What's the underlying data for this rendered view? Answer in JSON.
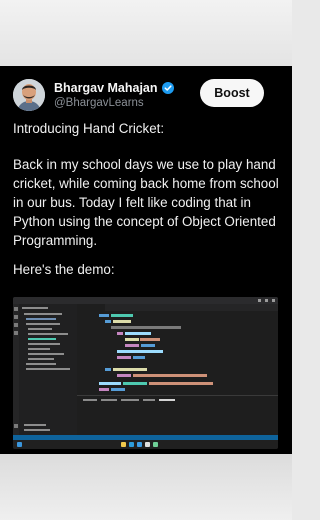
{
  "post": {
    "author_name": "Bhargav Mahajan",
    "author_handle": "@BhargavLearns",
    "verified": true,
    "action_button": "Boost",
    "paragraphs": [
      "Introducing Hand Cricket:",
      "Back in my school days we use to play hand cricket, while coming back home from school in our bus. Today I felt like coding that in Python using the concept of Object Oriented Programming.",
      "Here's the demo:"
    ]
  },
  "screenshot": {
    "code": [
      "class cricket:",
      "def play(self):",
      "if num==bowl:",
      "print(\"OUT!!\")",
      "return False",
      "self.runs.append(num)",
      "return True",
      "def totalscore(self):",
      "return f\"The total score: {sum(self.runs)}\"",
      "Bhargav= cricket(\"All Rounder\", \"Right Handed\")",
      "while(True):"
    ]
  },
  "colors": {
    "card_bg": "#000000",
    "handle": "#8b9097",
    "verified": "#1d9bf0",
    "vscode_status": "#0e639c",
    "keyword": "#569cd6",
    "function": "#dcdcaa",
    "string": "#ce9178",
    "control": "#c586c0"
  }
}
